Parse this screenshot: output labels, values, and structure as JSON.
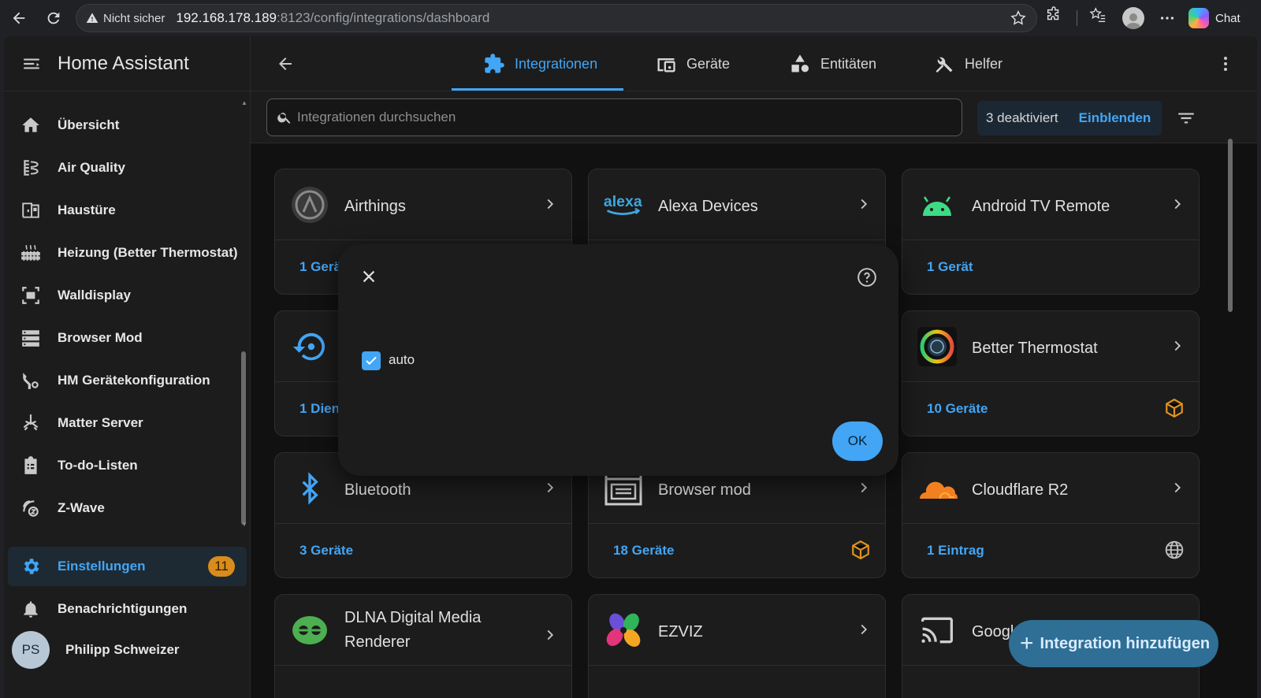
{
  "browser": {
    "security_label": "Nicht sicher",
    "url_host": "192.168.178.189",
    "url_rest": ":8123/config/integrations/dashboard",
    "chat_label": "Chat"
  },
  "sidebar": {
    "title": "Home Assistant",
    "items": [
      {
        "label": "Übersicht",
        "icon": "home-icon"
      },
      {
        "label": "Air Quality",
        "icon": "air-filter-icon"
      },
      {
        "label": "Haustüre",
        "icon": "door-icon"
      },
      {
        "label": "Heizung (Better Thermostat)",
        "icon": "radiator-icon"
      },
      {
        "label": "Walldisplay",
        "icon": "fullscreen-icon"
      },
      {
        "label": "Browser Mod",
        "icon": "server-icon"
      },
      {
        "label": "HM Gerätekonfiguration",
        "icon": "wrench-cog-icon"
      },
      {
        "label": "Matter Server",
        "icon": "matter-icon"
      },
      {
        "label": "To-do-Listen",
        "icon": "clipboard-list-icon"
      },
      {
        "label": "Z-Wave",
        "icon": "z-wave-icon"
      }
    ],
    "settings": {
      "label": "Einstellungen",
      "badge": "11"
    },
    "notifications": {
      "label": "Benachrichtigungen"
    },
    "user": {
      "initials": "PS",
      "name": "Philipp Schweizer"
    }
  },
  "tabs": [
    {
      "label": "Integrationen",
      "active": true
    },
    {
      "label": "Geräte",
      "active": false
    },
    {
      "label": "Entitäten",
      "active": false
    },
    {
      "label": "Helfer",
      "active": false
    }
  ],
  "search": {
    "placeholder": "Integrationen durchsuchen"
  },
  "disabled": {
    "count_label": "3 deaktiviert",
    "show_label": "Einblenden"
  },
  "cards": [
    {
      "name": "Airthings",
      "footer": "1 Gerä"
    },
    {
      "name": "Alexa Devices",
      "footer": ""
    },
    {
      "name": "Android TV Remote",
      "footer": "1 Gerät"
    },
    {
      "name": "",
      "footer": "1 Dien"
    },
    {
      "name": "",
      "footer": ""
    },
    {
      "name": "Better Thermostat",
      "footer": "10 Geräte"
    },
    {
      "name": "Bluetooth",
      "footer": "3 Geräte"
    },
    {
      "name": "Browser mod",
      "footer": "18 Geräte"
    },
    {
      "name": "Cloudflare R2",
      "footer": "1 Eintrag"
    },
    {
      "name": "DLNA Digital Media Renderer",
      "footer": ""
    },
    {
      "name": "EZVIZ",
      "footer": ""
    },
    {
      "name": "Googl",
      "footer": ""
    }
  ],
  "alexa_logo_text": "alexa",
  "fab": {
    "label": "Integration hinzufügen"
  },
  "dialog": {
    "checkbox_label": "auto",
    "checked": true,
    "ok_label": "OK"
  },
  "colors": {
    "accent": "#42a5f5",
    "badge": "#d98c1b",
    "fab": "#2f6e95",
    "custom_integration": "#e0941f"
  }
}
